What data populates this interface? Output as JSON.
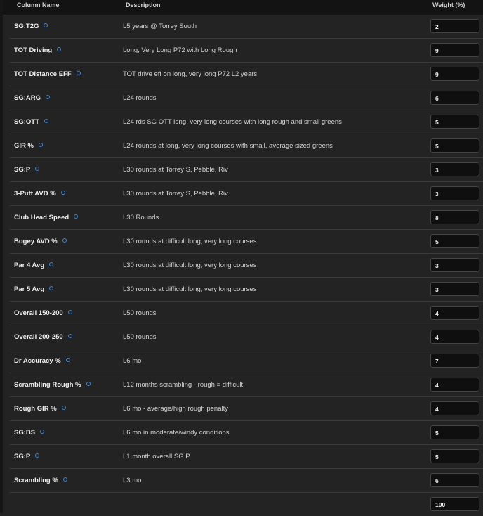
{
  "header": {
    "col_name": "Column Name",
    "col_description": "Description",
    "col_weight": "Weight (%)"
  },
  "rows": [
    {
      "name": "SG:T2G",
      "description": "L5 years @ Torrey South",
      "weight": "2"
    },
    {
      "name": "TOT Driving",
      "description": "Long, Very Long P72 with Long Rough",
      "weight": "9"
    },
    {
      "name": "TOT Distance EFF",
      "description": "TOT drive eff on long, very long P72 L2 years",
      "weight": "9"
    },
    {
      "name": "SG:ARG",
      "description": "L24 rounds",
      "weight": "6"
    },
    {
      "name": "SG:OTT",
      "description": "L24 rds SG OTT long, very long courses with long rough and small greens",
      "weight": "5"
    },
    {
      "name": "GIR %",
      "description": "L24 rounds at long, very long courses with small, average sized greens",
      "weight": "5"
    },
    {
      "name": "SG:P",
      "description": "L30 rounds at Torrey S, Pebble, Riv",
      "weight": "3"
    },
    {
      "name": "3-Putt AVD %",
      "description": "L30 rounds at Torrey S, Pebble, Riv",
      "weight": "3"
    },
    {
      "name": "Club Head Speed",
      "description": "L30 Rounds",
      "weight": "8"
    },
    {
      "name": "Bogey AVD %",
      "description": "L30 rounds at difficult long, very long courses",
      "weight": "5"
    },
    {
      "name": "Par 4 Avg",
      "description": "L30 rounds at difficult long, very long courses",
      "weight": "3"
    },
    {
      "name": "Par 5 Avg",
      "description": "L30 rounds at difficult long, very long courses",
      "weight": "3"
    },
    {
      "name": "Overall 150-200",
      "description": "L50 rounds",
      "weight": "4"
    },
    {
      "name": "Overall 200-250",
      "description": "L50 rounds",
      "weight": "4"
    },
    {
      "name": "Dr Accuracy %",
      "description": "L6 mo",
      "weight": "7"
    },
    {
      "name": "Scrambling Rough %",
      "description": "L12 months scrambling - rough = difficult",
      "weight": "4"
    },
    {
      "name": "Rough GIR %",
      "description": "L6 mo - average/high rough penalty",
      "weight": "4"
    },
    {
      "name": "SG:BS",
      "description": "L6 mo in moderate/windy conditions",
      "weight": "5"
    },
    {
      "name": "SG:P",
      "description": "L1 month overall SG P",
      "weight": "5"
    },
    {
      "name": "Scrambling %",
      "description": "L3 mo",
      "weight": "6"
    }
  ],
  "total": "100",
  "colors": {
    "accent": "#3d85d6",
    "background": "#232323",
    "input_bg": "#0f0f0f"
  }
}
